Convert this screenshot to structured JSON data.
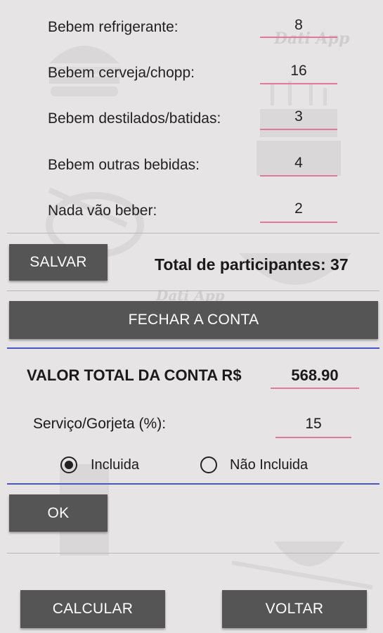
{
  "watermark": "Dati App",
  "participants": [
    {
      "label": "Bebem refrigerante:",
      "value": "8"
    },
    {
      "label": "Bebem cerveja/chopp:",
      "value": "16"
    },
    {
      "label": "Bebem destilados/batidas:",
      "value": "3"
    },
    {
      "label": "Bebem outras bebidas:",
      "value": "4"
    },
    {
      "label": "Nada vão beber:",
      "value": "2"
    }
  ],
  "salvar_label": "SALVAR",
  "total_participantes": "Total de participantes: 37",
  "fechar_label": "FECHAR A CONTA",
  "valor_total": {
    "label": "VALOR TOTAL DA CONTA R$",
    "value": "568.90"
  },
  "servico": {
    "label": "Serviço/Gorjeta (%):",
    "value": "15"
  },
  "radio": {
    "incluida": "Incluida",
    "nao_incluida": "Não Incluida",
    "selected": "incluida"
  },
  "ok_label": "OK",
  "calcular_label": "CALCULAR",
  "voltar_label": "VOLTAR",
  "colors": {
    "button": "#555555",
    "underline": "#e07a9a",
    "divider_blue": "#4a55c8",
    "background": "#e6e4e4"
  }
}
